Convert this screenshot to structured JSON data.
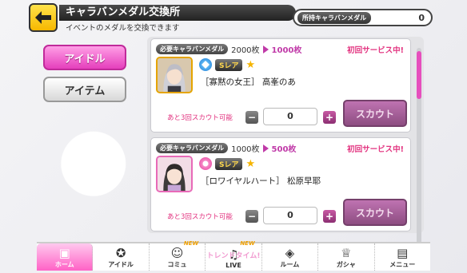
{
  "header": {
    "title": "キャラバンメダル交換所",
    "subtitle": "イベントのメダルを交換できます"
  },
  "owned": {
    "label": "所持キャラバンメダル",
    "value": "0"
  },
  "tabs": [
    {
      "label": "アイドル",
      "active": true
    },
    {
      "label": "アイテム",
      "active": false
    }
  ],
  "cards": [
    {
      "required_label": "必要キャラバンメダル",
      "old_cost": "2000枚",
      "new_cost": "1000枚",
      "first_service": "初回サービス中!",
      "attribute": "cool",
      "rarity": "Sレア",
      "name": "［寡黙の女王］ 高峯のあ",
      "remaining": "あと3回スカウト可能",
      "quantity": "0",
      "minus": "−",
      "plus": "+",
      "scout_label": "スカウト"
    },
    {
      "required_label": "必要キャラバンメダル",
      "old_cost": "1000枚",
      "new_cost": "500枚",
      "first_service": "初回サービス中!",
      "attribute": "cute",
      "rarity": "Sレア",
      "name": "［ロワイヤルハート］ 松原早耶",
      "remaining": "あと3回スカウト可能",
      "quantity": "0",
      "minus": "−",
      "plus": "+",
      "scout_label": "スカウト"
    }
  ],
  "nav": {
    "items": [
      {
        "label": "ホーム",
        "icon": "home-icon",
        "active": true
      },
      {
        "label": "アイドル",
        "icon": "star-badge-icon"
      },
      {
        "label": "コミュ",
        "icon": "chat-icon",
        "badge": "NEW"
      },
      {
        "label": "LIVE",
        "icon": "music-icon",
        "badge": "NEW",
        "overlay": "トレンドタイム!"
      },
      {
        "label": "ルーム",
        "icon": "cube-icon"
      },
      {
        "label": "ガシャ",
        "icon": "gacha-icon"
      },
      {
        "label": "メニュー",
        "icon": "menu-icon"
      }
    ]
  },
  "colors": {
    "accent_pink": "#e53fbc",
    "header_dark": "#222222",
    "back_button": "#f7b800",
    "discount_text": "#c03aa8",
    "first_service_text": "#e2327f"
  }
}
